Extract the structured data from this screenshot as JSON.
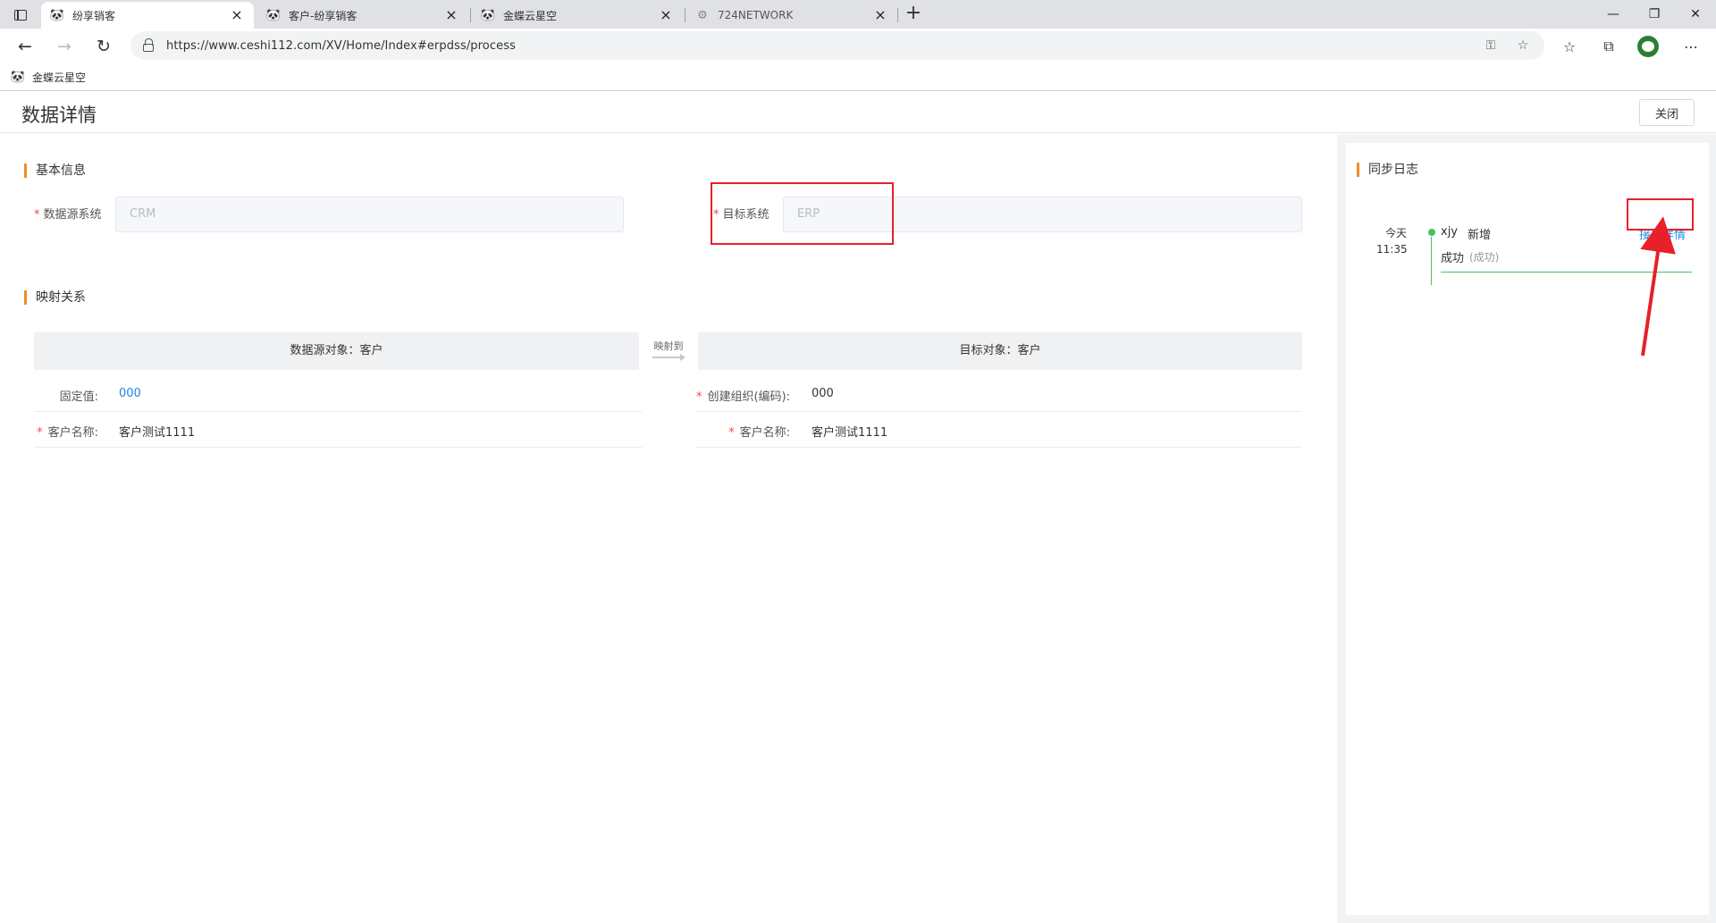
{
  "browser": {
    "tabs": [
      {
        "title": "纷享销客",
        "icon": "panda-favicon-icon",
        "active": true
      },
      {
        "title": "客户-纷享销客",
        "icon": "panda-favicon-icon",
        "active": false
      },
      {
        "title": "金蝶云星空",
        "icon": "panda-favicon-icon",
        "active": false
      },
      {
        "title": "724NETWORK",
        "icon": "gear-favicon-icon",
        "active": false
      }
    ],
    "url": "https://www.ceshi112.com/XV/Home/Index#erpdss/process",
    "bookmark": "金蝶云星空"
  },
  "page": {
    "title": "数据详情",
    "close_label": "关闭"
  },
  "basic_info": {
    "section_title": "基本信息",
    "source_label": "数据源系统",
    "source_value": "CRM",
    "target_label": "目标系统",
    "target_value": "ERP"
  },
  "mapping": {
    "section_title": "映射关系",
    "source_header": "数据源对象：客户",
    "target_header": "目标对象：客户",
    "map_to": "映射到",
    "source_rows": [
      {
        "label": "固定值:",
        "value": "000",
        "required": false
      },
      {
        "label": "客户名称:",
        "value": "客户测试1111",
        "required": true
      }
    ],
    "target_rows": [
      {
        "label": "创建组织(编码):",
        "value": "000",
        "required": true
      },
      {
        "label": "客户名称:",
        "value": "客户测试1111",
        "required": true
      }
    ],
    "required_mark": "*"
  },
  "sync_log": {
    "section_title": "同步日志",
    "entries": [
      {
        "day": "今天",
        "time": "11:35",
        "user": "xjy",
        "action": "新增",
        "status": "成功",
        "status_detail": "(成功)",
        "link": "接口详情"
      }
    ]
  },
  "colors": {
    "accent_orange": "#f28c28",
    "link_blue": "#1e88e5",
    "success_green": "#45c25f",
    "annotation_red": "#e8202a",
    "required_red": "#f04848"
  }
}
